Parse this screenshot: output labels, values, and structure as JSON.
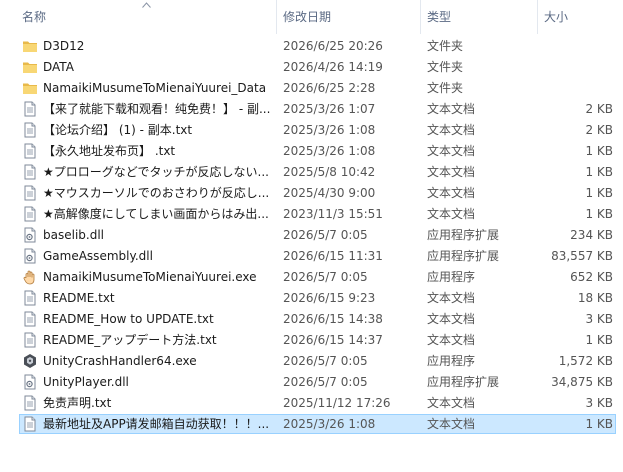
{
  "columns": {
    "name": "名称",
    "date": "修改日期",
    "type": "类型",
    "size": "大小"
  },
  "files": [
    {
      "name": "D3D12",
      "date": "2026/6/25 20:26",
      "type": "文件夹",
      "size": "",
      "icon": "folder-icon"
    },
    {
      "name": "DATA",
      "date": "2026/4/26 14:19",
      "type": "文件夹",
      "size": "",
      "icon": "folder-icon"
    },
    {
      "name": "NamaikiMusumeToMienaiYuurei_Data",
      "date": "2026/6/25 2:28",
      "type": "文件夹",
      "size": "",
      "icon": "folder-icon"
    },
    {
      "name": "【来了就能下载和观看！纯免费！】 - 副...",
      "date": "2025/3/26 1:07",
      "type": "文本文档",
      "size": "2 KB",
      "icon": "text-file-icon"
    },
    {
      "name": "【论坛介绍】 (1) - 副本.txt",
      "date": "2025/3/26 1:08",
      "type": "文本文档",
      "size": "2 KB",
      "icon": "text-file-icon"
    },
    {
      "name": "【永久地址发布页】 .txt",
      "date": "2025/3/26 1:08",
      "type": "文本文档",
      "size": "1 KB",
      "icon": "text-file-icon"
    },
    {
      "name": "★プロローグなどでタッチが反応しない...",
      "date": "2025/5/8 10:42",
      "type": "文本文档",
      "size": "1 KB",
      "icon": "text-file-icon"
    },
    {
      "name": "★マウスカーソルでのおさわりが反応し...",
      "date": "2025/4/30 9:00",
      "type": "文本文档",
      "size": "1 KB",
      "icon": "text-file-icon"
    },
    {
      "name": "★高解像度にしてしまい画面からはみ出...",
      "date": "2023/11/3 15:51",
      "type": "文本文档",
      "size": "1 KB",
      "icon": "text-file-icon"
    },
    {
      "name": "baselib.dll",
      "date": "2026/5/7 0:05",
      "type": "应用程序扩展",
      "size": "234 KB",
      "icon": "dll-icon"
    },
    {
      "name": "GameAssembly.dll",
      "date": "2026/6/15 11:31",
      "type": "应用程序扩展",
      "size": "83,557 KB",
      "icon": "dll-icon"
    },
    {
      "name": "NamaikiMusumeToMienaiYuurei.exe",
      "date": "2026/5/7 0:05",
      "type": "应用程序",
      "size": "652 KB",
      "icon": "exe-hand-icon"
    },
    {
      "name": "README.txt",
      "date": "2026/6/15 9:23",
      "type": "文本文档",
      "size": "18 KB",
      "icon": "text-file-icon"
    },
    {
      "name": "README_How to UPDATE.txt",
      "date": "2026/6/15 14:38",
      "type": "文本文档",
      "size": "3 KB",
      "icon": "text-file-icon"
    },
    {
      "name": "README_アップデート方法.txt",
      "date": "2026/6/15 14:37",
      "type": "文本文档",
      "size": "1 KB",
      "icon": "text-file-icon"
    },
    {
      "name": "UnityCrashHandler64.exe",
      "date": "2026/5/7 0:05",
      "type": "应用程序",
      "size": "1,572 KB",
      "icon": "unity-icon"
    },
    {
      "name": "UnityPlayer.dll",
      "date": "2026/5/7 0:05",
      "type": "应用程序扩展",
      "size": "34,875 KB",
      "icon": "dll-icon"
    },
    {
      "name": "免责声明.txt",
      "date": "2025/11/12 17:26",
      "type": "文本文档",
      "size": "3 KB",
      "icon": "text-file-icon"
    },
    {
      "name": "最新地址及APP请发邮箱自动获取！！！...",
      "date": "2025/3/26 1:08",
      "type": "文本文档",
      "size": "1 KB",
      "icon": "text-file-icon",
      "selected": true
    }
  ]
}
